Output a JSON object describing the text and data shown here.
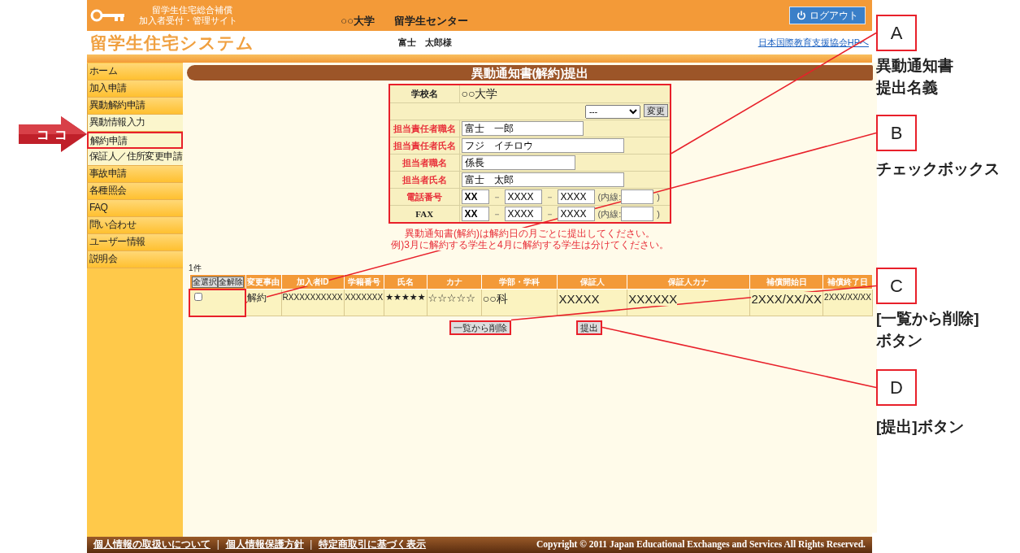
{
  "pointer": {
    "label": "ココ"
  },
  "header": {
    "caption_lines": [
      "留学生住宅総合補償",
      "加入者受付・管理サイト"
    ],
    "university": "○○大学",
    "center": "留学生センター",
    "logout_button": "ログアウト",
    "system_title": "留学生住宅システム",
    "user_name": "富士　太郎様",
    "link": "日本国際教育支援協会HPへ"
  },
  "sidebar": {
    "items": [
      {
        "label": "ホーム",
        "highlighted": false
      },
      {
        "label": "加入申請",
        "highlighted": false
      },
      {
        "label": "異動解約申請",
        "highlighted": false,
        "children": [
          {
            "label": "異動情報入力",
            "highlighted": false
          },
          {
            "label": "解約申請",
            "highlighted": true
          },
          {
            "label": "保証人／住所変更申請",
            "highlighted": false
          }
        ]
      },
      {
        "label": "事故申請",
        "highlighted": false
      },
      {
        "label": "各種照会",
        "highlighted": false
      },
      {
        "label": "FAQ",
        "highlighted": false
      },
      {
        "label": "問い合わせ",
        "highlighted": false
      },
      {
        "label": "ユーザー情報",
        "highlighted": false
      },
      {
        "label": "説明会",
        "highlighted": false
      }
    ]
  },
  "page_title": "異動通知書(解約)提出",
  "form": {
    "highlighted": true,
    "school_label": "学校名",
    "school_value": "○○大学",
    "select_value": "---",
    "change_button": "変更",
    "fields": [
      {
        "kind": "text",
        "label": "担当責任者職名",
        "required": true,
        "value": "富士　一郎"
      },
      {
        "kind": "text",
        "label": "担当責任者氏名",
        "required": true,
        "value": "フジ　イチロウ"
      },
      {
        "kind": "text",
        "label": "担当者職名",
        "required": true,
        "value": "係長"
      },
      {
        "kind": "text",
        "label": "担当者氏名",
        "required": true,
        "value": "富士　太郎"
      },
      {
        "kind": "phone",
        "label": "電話番号",
        "required": true,
        "parts": [
          "XX",
          "XXXX",
          "XXXX"
        ],
        "separators": [
          "－",
          "－"
        ],
        "extension_label": "(内線:",
        "closing": ")"
      },
      {
        "kind": "phone",
        "label": "FAX",
        "required": false,
        "parts": [
          "XX",
          "XXXX",
          "XXXX"
        ],
        "separators": [
          "－",
          "－"
        ],
        "extension_label": "(内線:",
        "closing": ")"
      }
    ]
  },
  "notice": [
    "異動通知書(解約)は解約日の月ごとに提出してください。",
    "例)3月に解約する学生と4月に解約する学生は分けてください。"
  ],
  "count": "1件",
  "table": {
    "select_all": "全選択",
    "deselect_all": "全解除",
    "columns": [
      "変更事由",
      "加入者ID",
      "学籍番号",
      "氏名",
      "カナ",
      "学部・学科",
      "保証人",
      "保証人カナ",
      "補償開始日",
      "補償終了日"
    ],
    "rows": [
      {
        "checked": false,
        "highlighted": true,
        "cells": [
          "解約",
          "RXXXXXXXXXX",
          "XXXXXXX",
          "★★★★★",
          "☆☆☆☆☆",
          "○○科",
          "XXXXX",
          "XXXXXX",
          "2XXX/XX/XX",
          "2XXX/XX/XX"
        ]
      }
    ]
  },
  "actions": [
    {
      "label": "一覧から削除",
      "highlighted": true
    },
    {
      "label": "提出",
      "highlighted": true
    }
  ],
  "footer": {
    "links": [
      "個人情報の取扱いについて",
      "個人情報保護方針",
      "特定商取引に基づく表示"
    ],
    "separators": [
      "|",
      "|"
    ],
    "copyright": "Copyright © 2011 Japan Educational Exchanges and Services All Rights Reserved."
  },
  "annotations": [
    {
      "letter": "A",
      "caption": [
        "異動通知書",
        "提出名義"
      ]
    },
    {
      "letter": "B",
      "caption": [
        "チェックボックス"
      ]
    },
    {
      "letter": "C",
      "caption": [
        "[一覧から削除]",
        "ボタン"
      ]
    },
    {
      "letter": "D",
      "caption": [
        "[提出]ボタン"
      ]
    }
  ]
}
